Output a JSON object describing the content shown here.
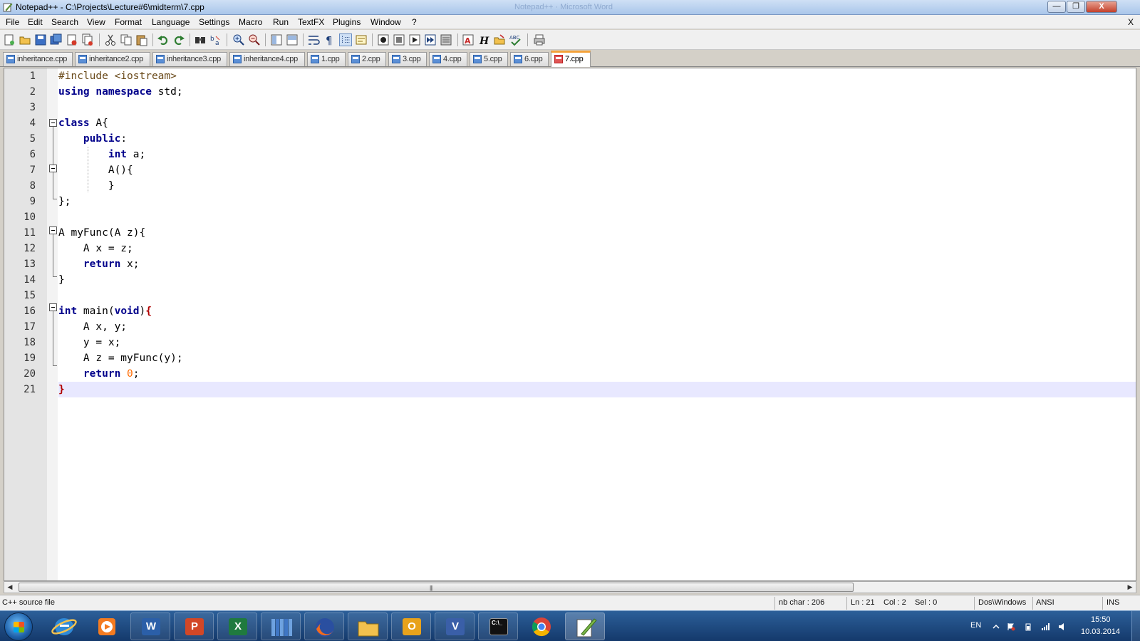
{
  "window": {
    "title": "Notepad++ - C:\\Projects\\Lecture#6\\midterm\\7.cpp",
    "ghost_title": "Notepad++  ·  Microsoft Word",
    "minimize_label": "—",
    "restore_label": "❐",
    "close_label": "X"
  },
  "menu": {
    "items": [
      "File",
      "Edit",
      "Search",
      "View",
      "Format",
      "Language",
      "Settings",
      "Macro",
      "Run",
      "TextFX",
      "Plugins",
      "Window",
      "?"
    ],
    "doc_close": "X"
  },
  "toolbar": {
    "icons": [
      "new-file-icon",
      "open-file-icon",
      "save-icon",
      "save-all-icon",
      "close-icon",
      "close-all-icon",
      "print-icon",
      "cut-icon",
      "copy-icon",
      "paste-icon",
      "undo-icon",
      "redo-icon",
      "find-icon",
      "replace-icon",
      "zoom-in-icon",
      "zoom-out-icon",
      "sync-vertical-icon",
      "sync-horizontal-icon",
      "word-wrap-icon",
      "show-all-chars-icon",
      "indent-guide-icon",
      "user-language-icon",
      "record-macro-icon",
      "stop-macro-icon",
      "play-macro-icon",
      "run-macro-multiple-icon",
      "save-macro-icon",
      "tidy-icon",
      "header-icon",
      "folder-icon",
      "spellcheck-icon",
      "print-now-icon"
    ]
  },
  "tabs": [
    {
      "label": "inheritance.cpp",
      "active": false
    },
    {
      "label": "inheritance2.cpp",
      "active": false
    },
    {
      "label": "inheritance3.cpp",
      "active": false
    },
    {
      "label": "inheritance4.cpp",
      "active": false
    },
    {
      "label": "1.cpp",
      "active": false
    },
    {
      "label": "2.cpp",
      "active": false
    },
    {
      "label": "3.cpp",
      "active": false
    },
    {
      "label": "4.cpp",
      "active": false
    },
    {
      "label": "5.cpp",
      "active": false
    },
    {
      "label": "6.cpp",
      "active": false
    },
    {
      "label": "7.cpp",
      "active": true
    }
  ],
  "editor": {
    "current_line": 21,
    "lines": [
      {
        "no": "1",
        "text": "#include <iostream>"
      },
      {
        "no": "2",
        "text": "using namespace std;"
      },
      {
        "no": "3",
        "text": ""
      },
      {
        "no": "4",
        "text": "class A{"
      },
      {
        "no": "5",
        "text": "    public:"
      },
      {
        "no": "6",
        "text": "        int a;"
      },
      {
        "no": "7",
        "text": "        A(){"
      },
      {
        "no": "8",
        "text": "        }"
      },
      {
        "no": "9",
        "text": "};"
      },
      {
        "no": "10",
        "text": ""
      },
      {
        "no": "11",
        "text": "A myFunc(A z){"
      },
      {
        "no": "12",
        "text": "    A x = z;"
      },
      {
        "no": "13",
        "text": "    return x;"
      },
      {
        "no": "14",
        "text": "}"
      },
      {
        "no": "15",
        "text": ""
      },
      {
        "no": "16",
        "text": "int main(void){"
      },
      {
        "no": "17",
        "text": "    A x, y;"
      },
      {
        "no": "18",
        "text": "    y = x;"
      },
      {
        "no": "19",
        "text": "    A z = myFunc(y);"
      },
      {
        "no": "20",
        "text": "    return 0;"
      },
      {
        "no": "21",
        "text": "}"
      }
    ]
  },
  "scrollbar": {
    "left_arrow": "◀",
    "right_arrow": "▶",
    "grip": "|||"
  },
  "status": {
    "file_type": "C++ source file",
    "nb_char": "nb char : 206",
    "ln": "Ln : 21",
    "col": "Col : 2",
    "sel": "Sel : 0",
    "eol": "Dos\\Windows",
    "encoding": "ANSI",
    "mode": "INS"
  },
  "taskbar": {
    "apps": [
      "internet-explorer-icon",
      "media-player-icon",
      "word-icon",
      "powerpoint-icon",
      "excel-icon",
      "library-icon",
      "firefox-icon",
      "file-explorer-icon",
      "outlook-icon",
      "visio-icon",
      "command-prompt-icon",
      "chrome-icon",
      "notepad-plus-plus-icon"
    ],
    "glyphs": {
      "word": "W",
      "powerpoint": "P",
      "excel": "X",
      "outlook": "O",
      "visio": "V",
      "cmd": "C:\\_"
    },
    "language": "EN",
    "time": "15:50",
    "date": "10.03.2014"
  },
  "colors": {
    "keyword": "#00008b",
    "number": "#ff6a00",
    "brace_match": "#b00000",
    "current_line": "#e8e8ff",
    "active_tab_accent": "#f4a23a",
    "taskbar": "#1f4d85"
  }
}
